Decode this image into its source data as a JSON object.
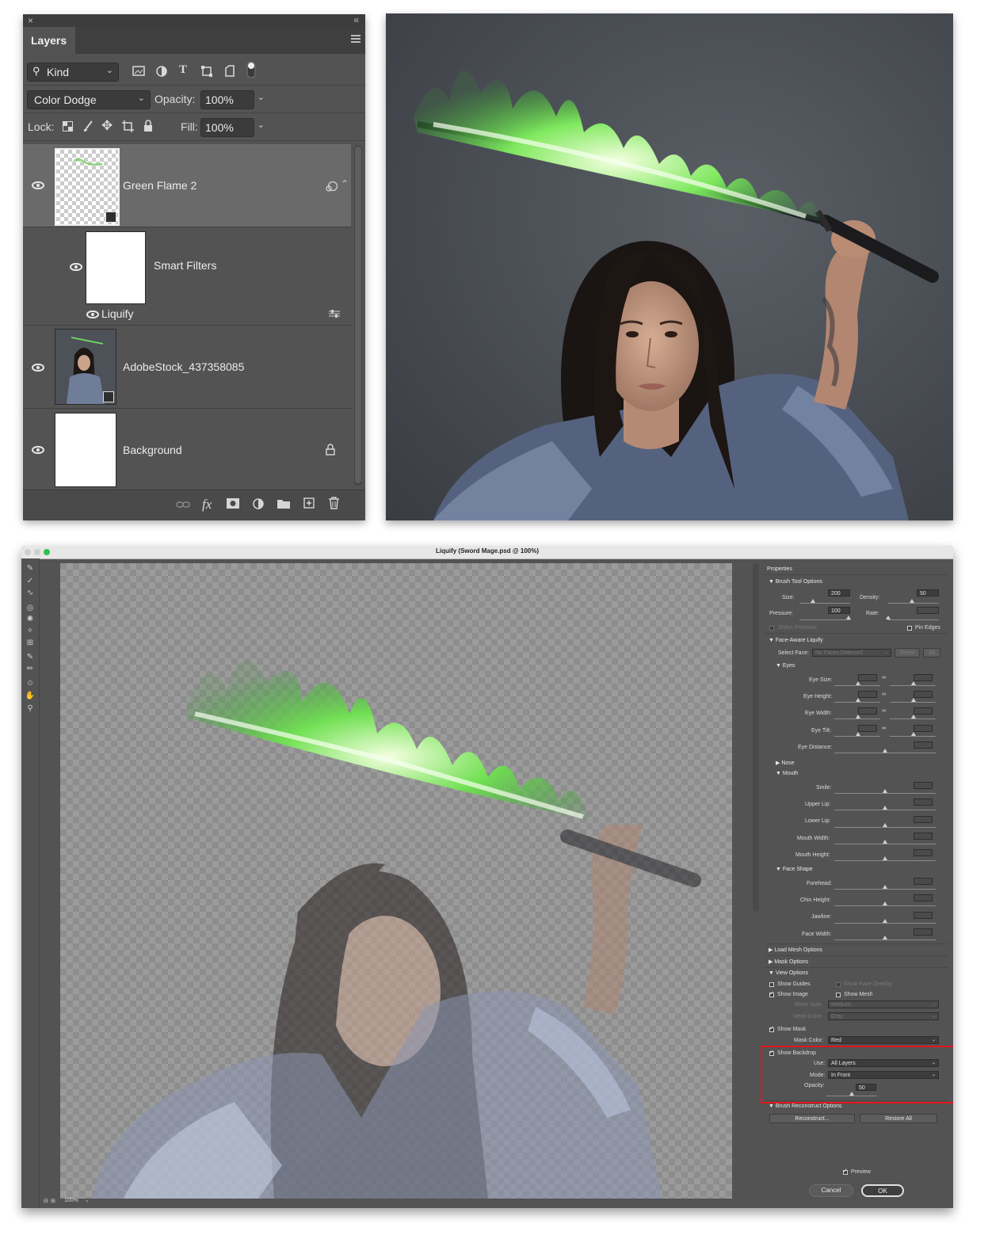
{
  "layers_panel": {
    "close_glyph": "×",
    "collapse_glyph": "«",
    "tab_label": "Layers",
    "filter_kind": "Kind",
    "blend_mode": "Color Dodge",
    "opacity_label": "Opacity:",
    "opacity_value": "100%",
    "lock_label": "Lock:",
    "fill_label": "Fill:",
    "fill_value": "100%",
    "layers": [
      {
        "name": "Green Flame 2",
        "visible": true,
        "selected": true
      },
      {
        "name": "Smart Filters",
        "visible": true
      },
      {
        "name": "Liquify",
        "visible": true
      },
      {
        "name": "AdobeStock_437358085",
        "visible": true
      },
      {
        "name": "Background",
        "visible": true,
        "locked": true
      }
    ]
  },
  "liquify_dialog": {
    "title": "Liquify (Sword Mage.psd @ 100%)",
    "zoom": "100%",
    "properties_label": "Properties",
    "brush_tool_options": {
      "header": "Brush Tool Options",
      "size_label": "Size:",
      "size_value": "200",
      "density_label": "Density:",
      "density_value": "50",
      "pressure_label": "Pressure:",
      "pressure_value": "100",
      "rate_label": "Rate:",
      "stylus_pressure": "Stylus Pressure",
      "pin_edges": "Pin Edges"
    },
    "face_aware": {
      "header": "Face-Aware Liquify",
      "select_face_label": "Select Face:",
      "select_face_value": "No Faces Detected",
      "reset": "Reset",
      "all": "All",
      "eyes_header": "Eyes",
      "eye_size": "Eye Size:",
      "eye_height": "Eye Height:",
      "eye_width": "Eye Width:",
      "eye_tilt": "Eye Tilt:",
      "eye_distance": "Eye Distance:",
      "nose_header": "Nose",
      "mouth_header": "Mouth",
      "smile": "Smile:",
      "upper_lip": "Upper Lip:",
      "lower_lip": "Lower Lip:",
      "mouth_width": "Mouth Width:",
      "mouth_height": "Mouth Height:",
      "face_shape_header": "Face Shape",
      "forehead": "Forehead:",
      "chin_height": "Chin Height:",
      "jawline": "Jawline:",
      "face_width": "Face Width:"
    },
    "load_mesh_options": "Load Mesh Options",
    "mask_options": "Mask Options",
    "view_options": {
      "header": "View Options",
      "show_guides": "Show Guides",
      "show_face_overlay": "Show Face Overlay",
      "show_image": "Show Image",
      "show_mesh": "Show Mesh",
      "mesh_size_label": "Mesh Size:",
      "mesh_size_value": "Medium",
      "mesh_color_label": "Mesh Color:",
      "mesh_color_value": "Gray",
      "show_mask": "Show Mask",
      "mask_color_label": "Mask Color:",
      "mask_color_value": "Red",
      "show_backdrop": "Show Backdrop",
      "use_label": "Use:",
      "use_value": "All Layers",
      "mode_label": "Mode:",
      "mode_value": "In Front",
      "opacity_label": "Opacity:",
      "opacity_value": "50"
    },
    "brush_reconstruct": {
      "header": "Brush Reconstruct Options",
      "reconstruct": "Reconstruct...",
      "restore_all": "Restore All"
    },
    "preview": "Preview",
    "cancel": "Cancel",
    "ok": "OK"
  },
  "colors": {
    "panel_bg": "#535353",
    "highlight": "#e2141e",
    "flame_green": "#5ee04a"
  }
}
